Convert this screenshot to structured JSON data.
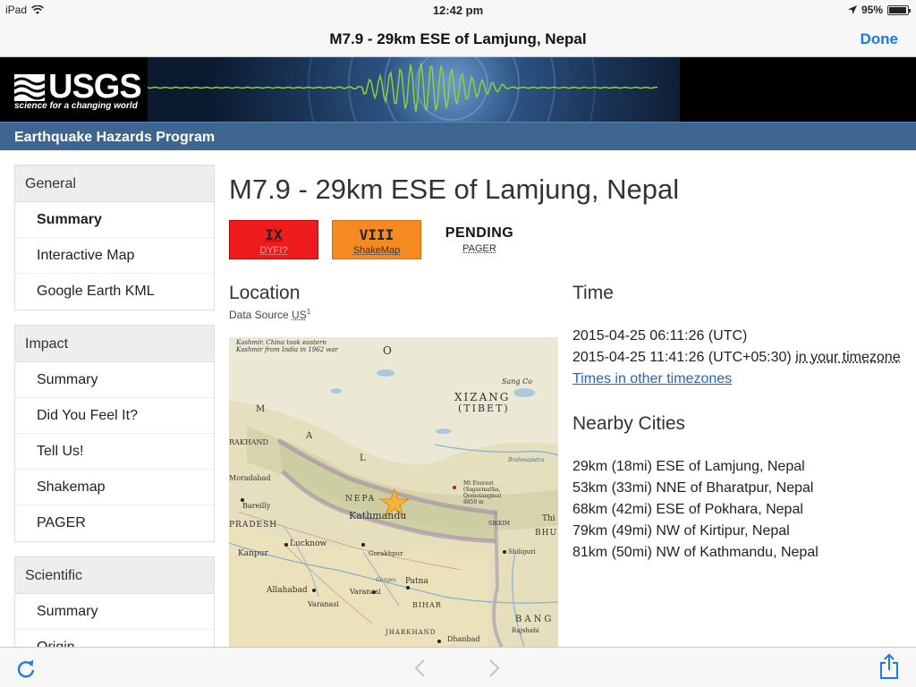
{
  "status": {
    "device": "iPad",
    "time": "12:42 pm",
    "battery": "95%",
    "battery_level": 0.95
  },
  "nav": {
    "title": "M7.9 - 29km ESE of Lamjung, Nepal",
    "done": "Done"
  },
  "banner": {
    "logo": "USGS",
    "tagline": "science for a changing world"
  },
  "program": {
    "title": "Earthquake Hazards Program"
  },
  "sidebar": {
    "general": {
      "head": "General",
      "items": [
        "Summary",
        "Interactive Map",
        "Google Earth KML"
      ]
    },
    "impact": {
      "head": "Impact",
      "items": [
        "Summary",
        "Did You Feel It?",
        "Tell Us!",
        "Shakemap",
        "PAGER"
      ]
    },
    "scientific": {
      "head": "Scientific",
      "items": [
        "Summary",
        "Origin"
      ]
    }
  },
  "event": {
    "title": "M7.9 - 29km ESE of Lamjung, Nepal",
    "badges": {
      "dyfi": {
        "level": "IX",
        "source": "DYFI?"
      },
      "shakemap": {
        "level": "VIII",
        "source": "ShakeMap"
      },
      "pager": {
        "level": "PENDING",
        "source": "PAGER"
      }
    }
  },
  "location": {
    "heading": "Location",
    "data_source_label": "Data Source",
    "data_source_network": "US",
    "data_source_sup": "1",
    "map_labels": {
      "kashmir": "Kashmir. China took eastern Kashmir from India in 1962 war",
      "o": "O",
      "xizang": "XIZANG",
      "tibet": "(TIBET)",
      "sang": "Sang Co",
      "m": "M",
      "a": "A",
      "l": "L",
      "hakhand": "RAKHAND",
      "moradabad": "Moradabad",
      "bareilly": "Bareilly",
      "nepa": "NEPA",
      "kathmandu": "Kathmandu",
      "pradesh": "PRADESH",
      "lucknow": "Lucknow",
      "gorakhpur": "Gorakhpur",
      "kanpur": "Kanpur",
      "everest": "Mt Everest (Sagarmatha, Qomolangma)",
      "everest_elev": "8850 m",
      "brahmaputra": "Brahmaputra",
      "sikkim": "SIKKIM",
      "thi": "Thi",
      "bhu": "BHU",
      "shiliguri": "Shiliguri",
      "allahabad": "Allahabad",
      "varanasi": "Varanasi",
      "varanasi2": "Varanasi",
      "patna": "Patna",
      "bihar": "BIHAR",
      "ganges": "Ganges",
      "bang": "BANG",
      "jharkhand": "JHARKHAND",
      "dhanbad": "Dhanbad",
      "rajshahi": "Rajshahi"
    }
  },
  "time": {
    "heading": "Time",
    "utc": "2015-04-25 06:11:26 (UTC)",
    "local": "2015-04-25 11:41:26 (UTC+05:30)",
    "local_suffix": "in your timezone",
    "other_link": "Times in other timezones"
  },
  "nearby": {
    "heading": "Nearby Cities",
    "cities": [
      "29km (18mi) ESE of Lamjung, Nepal",
      "53km (33mi) NNE of Bharatpur, Nepal",
      "68km (42mi) ESE of Pokhara, Nepal",
      "79km (49mi) NW of Kirtipur, Nepal",
      "81km (50mi) NW of Kathmandu, Nepal"
    ]
  },
  "toolbar": {
    "reload": "reload-icon",
    "back": "back-icon",
    "forward": "forward-icon",
    "share": "share-icon"
  },
  "colors": {
    "accent": "#1a7ae8",
    "program_bar": "#3d6590",
    "dyfi": "#ee1c1c",
    "shakemap": "#f58a21",
    "link": "#2266bb"
  }
}
